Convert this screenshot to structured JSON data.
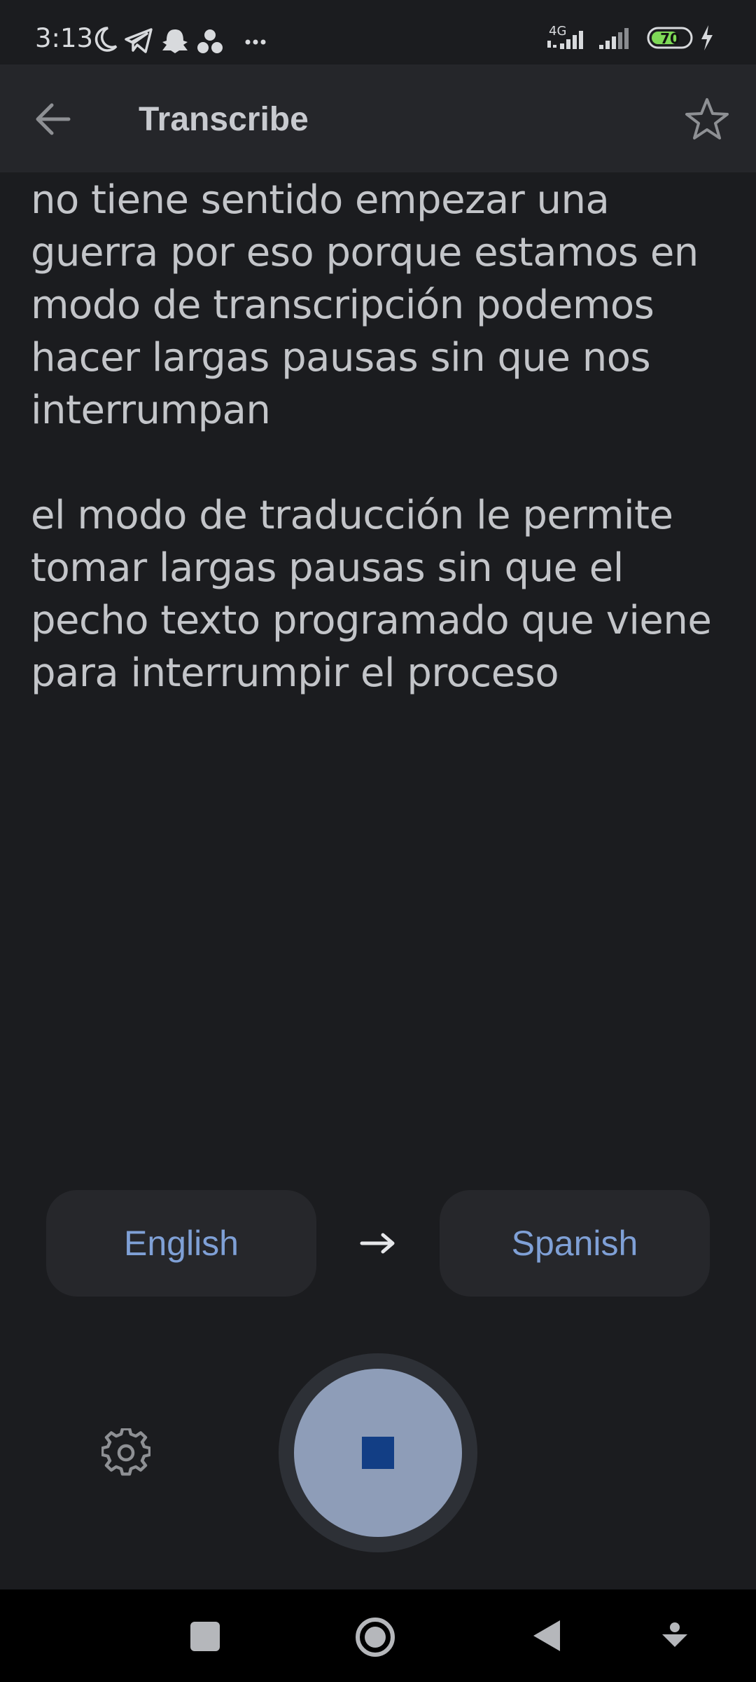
{
  "status_bar": {
    "time": "3:13",
    "network_label": "4G",
    "battery_level": "70"
  },
  "app_bar": {
    "title": "Transcribe"
  },
  "transcript": {
    "paragraphs": [
      "no tiene sentido empezar una guerra por eso porque estamos en modo de transcripción podemos hacer largas pausas sin que nos interrumpan",
      "el modo de traducción le permite tomar largas pausas sin que el pecho texto programado que viene para interrumpir el proceso"
    ]
  },
  "languages": {
    "source": "English",
    "target": "Spanish"
  },
  "colors": {
    "background": "#1b1c1f",
    "app_bar": "#25262a",
    "accent_text": "#7fa0d6",
    "record_button": "#8e9db8",
    "stop_icon": "#123e85",
    "battery": "#7ed957"
  },
  "icons": {
    "back": "arrow-left-icon",
    "favorite": "star-outline-icon",
    "swap": "arrow-right-icon",
    "settings": "gear-icon",
    "stop": "stop-icon"
  }
}
